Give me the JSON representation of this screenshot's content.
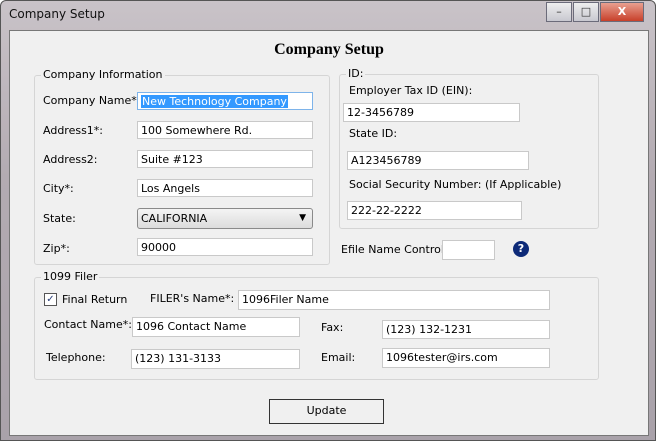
{
  "window": {
    "title": "Company Setup",
    "min": "–",
    "max": "□",
    "close": "X"
  },
  "heading": "Company Setup",
  "company": {
    "group": "Company Information",
    "fields": [
      {
        "label": "Company Name*:",
        "value": "New Technology Company"
      },
      {
        "label": "Address1*:",
        "value": "100 Somewhere Rd."
      },
      {
        "label": "Address2:",
        "value": "Suite #123"
      },
      {
        "label": "City*:",
        "value": "Los Angels"
      },
      {
        "label": "State:",
        "value": "CALIFORNIA"
      },
      {
        "label": "Zip*:",
        "value": "90000"
      }
    ]
  },
  "id": {
    "group": "ID:",
    "ein_label": "Employer Tax ID (EIN):",
    "ein": "12-3456789",
    "state_label": "State ID:",
    "state_id": "A123456789",
    "ssn_label": "Social Security Number: (If Applicable)",
    "ssn": "222-22-2222"
  },
  "efile": {
    "label": "Efile Name Control:",
    "value": "",
    "help": "?"
  },
  "filer": {
    "group": "1099 Filer",
    "final_return": "Final Return",
    "final_checked": true,
    "check": "✓",
    "name_label": "FILER's Name*:",
    "name": "1096Filer  Name",
    "contact_label": "Contact Name*:",
    "contact": "1096 Contact Name",
    "fax_label": "Fax:",
    "fax": "(123) 132-1231",
    "tel_label": "Telephone:",
    "tel": "(123) 131-3133",
    "email_label": "Email:",
    "email": "1096tester@irs.com"
  },
  "update": "Update"
}
